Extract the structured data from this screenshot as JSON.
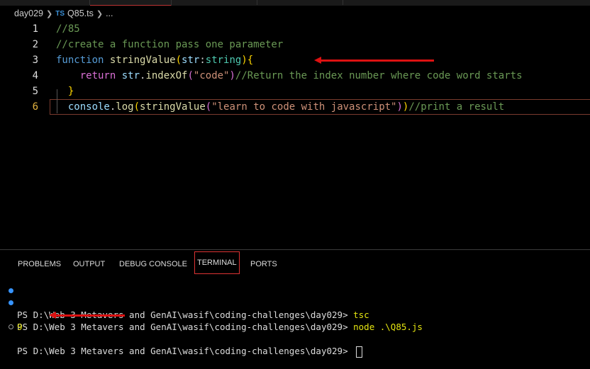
{
  "breadcrumb": {
    "folder": "day029",
    "file_icon": "TS",
    "file": "Q85.ts",
    "more": "..."
  },
  "editor": {
    "lines": [
      {
        "num": "1",
        "tokens": [
          {
            "t": "//85",
            "c": "comment"
          }
        ]
      },
      {
        "num": "2",
        "tokens": [
          {
            "t": "//create a function pass one parameter",
            "c": "comment"
          }
        ]
      },
      {
        "num": "3",
        "tokens": [
          {
            "t": "function",
            "c": "kw"
          },
          {
            "t": " ",
            "c": "plain"
          },
          {
            "t": "stringValue",
            "c": "fn"
          },
          {
            "t": "(",
            "c": "brk"
          },
          {
            "t": "str",
            "c": "var"
          },
          {
            "t": ":",
            "c": "plain"
          },
          {
            "t": "string",
            "c": "type"
          },
          {
            "t": ")",
            "c": "brk"
          },
          {
            "t": "{",
            "c": "brk"
          }
        ]
      },
      {
        "num": "4",
        "tokens": [
          {
            "t": "    return ",
            "c": "kw2"
          },
          {
            "t": "str",
            "c": "var"
          },
          {
            "t": ".",
            "c": "plain"
          },
          {
            "t": "indexOf",
            "c": "fn"
          },
          {
            "t": "(",
            "c": "brk2"
          },
          {
            "t": "\"code\"",
            "c": "str"
          },
          {
            "t": ")",
            "c": "brk2"
          },
          {
            "t": "//Return the index number where code word starts",
            "c": "comment"
          }
        ]
      },
      {
        "num": "5",
        "tokens": [
          {
            "t": "  }",
            "c": "brk"
          }
        ]
      },
      {
        "num": "6",
        "tokens": [
          {
            "t": "  console",
            "c": "var"
          },
          {
            "t": ".",
            "c": "plain"
          },
          {
            "t": "log",
            "c": "fn"
          },
          {
            "t": "(",
            "c": "brk"
          },
          {
            "t": "stringValue",
            "c": "fn"
          },
          {
            "t": "(",
            "c": "brk2"
          },
          {
            "t": "\"learn to code with javascript\"",
            "c": "str"
          },
          {
            "t": ")",
            "c": "brk2"
          },
          {
            "t": ")",
            "c": "brk"
          },
          {
            "t": "//print a result",
            "c": "comment"
          }
        ]
      }
    ]
  },
  "panel": {
    "tabs": [
      "PROBLEMS",
      "OUTPUT",
      "DEBUG CONSOLE",
      "TERMINAL",
      "PORTS"
    ],
    "active_tab": "TERMINAL"
  },
  "terminal": {
    "lines": [
      {
        "prompt": "PS D:\\Web 3 Metavers and GenAI\\wasif\\coding-challenges\\day029> ",
        "cmd": "tsc"
      },
      {
        "prompt": "PS D:\\Web 3 Metavers and GenAI\\wasif\\coding-challenges\\day029> ",
        "cmd": "node .\\Q85.js"
      },
      {
        "prompt": "",
        "cmd": "9"
      },
      {
        "prompt": "PS D:\\Web 3 Metavers and GenAI\\wasif\\coding-challenges\\day029> ",
        "cmd": ""
      }
    ]
  },
  "colors": {
    "keyword": "#569cd6",
    "function": "#dcdcaa",
    "string": "#ce9178",
    "comment": "#6a9955",
    "annotation_arrow": "#dd1111"
  }
}
